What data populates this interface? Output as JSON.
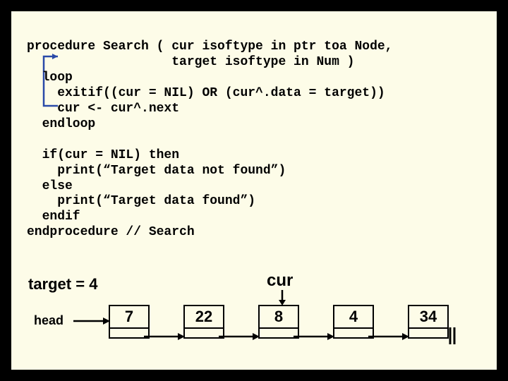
{
  "code": {
    "line1": "procedure Search ( cur isoftype in ptr toa Node,",
    "line2": "                   target isoftype in Num )",
    "line3": "  loop",
    "line4": "    exitif((cur = NIL) OR (cur^.data = target))",
    "line5": "    cur <- cur^.next",
    "line6": "  endloop",
    "line7": "",
    "line8": "  if(cur = NIL) then",
    "line9": "    print(“Target data not found”)",
    "line10": "  else",
    "line11": "    print(“Target data found”)",
    "line12": "  endif",
    "line13": "endprocedure // Search"
  },
  "diagram": {
    "target_label": "target = 4",
    "cur_label": "cur",
    "head_label": "head",
    "nodes": [
      "7",
      "22",
      "8",
      "4",
      "34"
    ]
  }
}
